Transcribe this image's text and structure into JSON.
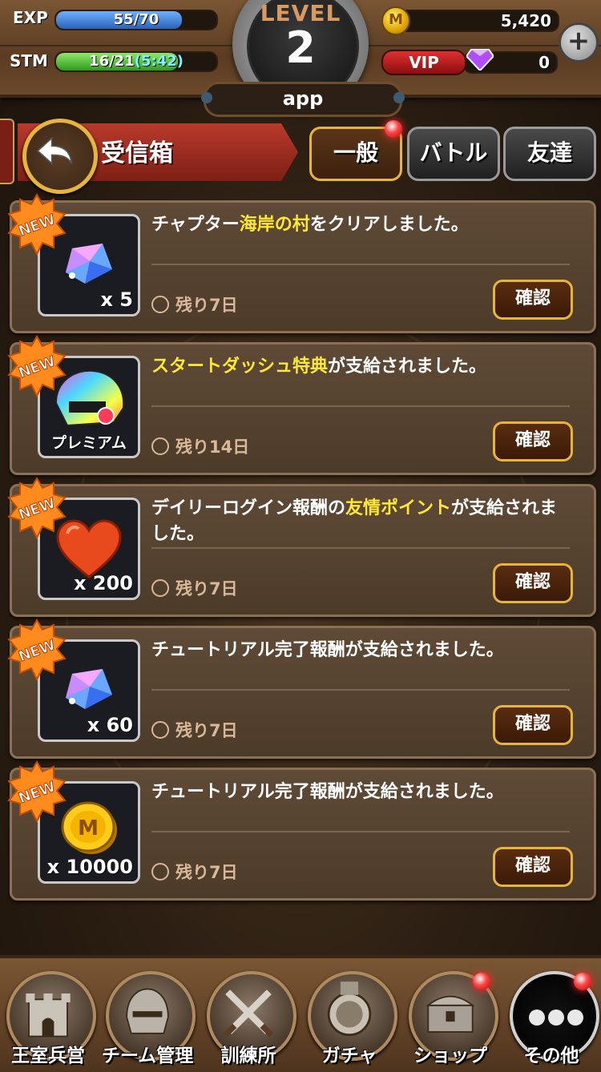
{
  "header": {
    "exp_label": "EXP",
    "exp_value": "55/70",
    "exp_progress": 0.786,
    "stm_label": "STM",
    "stm_value": "16/21",
    "stm_timer": "(5:42)",
    "stm_progress": 0.762,
    "level_word": "LEVEL",
    "level_number": "2",
    "app_name": "app",
    "coins": "5,420",
    "vip_label": "VIP",
    "gems": "0",
    "coin_glyph": "M",
    "plus_glyph": "+"
  },
  "title": {
    "text": "受信箱",
    "back_icon": "back-arrow-icon"
  },
  "tabs": [
    {
      "label": "一般",
      "active": true,
      "notification": true
    },
    {
      "label": "バトル",
      "active": false,
      "notification": false
    },
    {
      "label": "友達",
      "active": false,
      "notification": false
    }
  ],
  "messages": [
    {
      "badge": "NEW",
      "item": "gem-crystal",
      "qty": "x 5",
      "text_before": "チャプター",
      "highlight": "海岸の村",
      "text_after": "をクリアしました。",
      "remaining": "残り7日",
      "button": "確認"
    },
    {
      "badge": "NEW",
      "item": "premium-helmet",
      "qty": "プレミアム",
      "text_before": "",
      "highlight": "スタートダッシュ特典",
      "text_after": "が支給されました。",
      "remaining": "残り14日",
      "button": "確認"
    },
    {
      "badge": "NEW",
      "item": "heart",
      "qty": "x 200",
      "text_before": "デイリーログイン報酬の",
      "highlight": "友情ポイント",
      "text_after": "が支給されました。",
      "remaining": "残り7日",
      "button": "確認"
    },
    {
      "badge": "NEW",
      "item": "gem-crystal",
      "qty": "x 60",
      "text_before": "チュートリアル完了報酬が支給されました。",
      "highlight": "",
      "text_after": "",
      "remaining": "残り7日",
      "button": "確認"
    },
    {
      "badge": "NEW",
      "item": "gold-coin",
      "qty": "x 10000",
      "text_before": "チュートリアル完了報酬が支給されました。",
      "highlight": "",
      "text_after": "",
      "remaining": "残り7日",
      "button": "確認"
    }
  ],
  "nav": [
    {
      "label": "王室兵営",
      "icon": "castle-icon",
      "notification": false
    },
    {
      "label": "チーム管理",
      "icon": "knight-helmet-icon",
      "notification": false
    },
    {
      "label": "訓練所",
      "icon": "crossed-swords-icon",
      "notification": false
    },
    {
      "label": "ガチャ",
      "icon": "gacha-medal-icon",
      "notification": false
    },
    {
      "label": "ショップ",
      "icon": "treasure-chest-icon",
      "notification": true
    },
    {
      "label": "その他",
      "icon": "more-dots-icon",
      "notification": true
    }
  ],
  "colors": {
    "exp_bar": "#3a7fd8",
    "stm_bar": "#4fc33a",
    "highlight_text": "#ffe833",
    "accent_gold": "#e6b53a"
  }
}
